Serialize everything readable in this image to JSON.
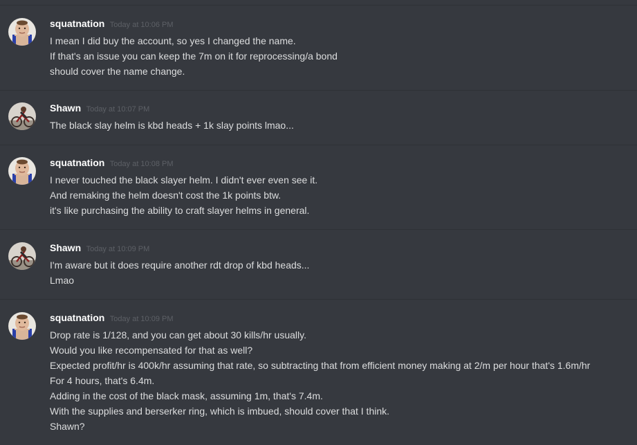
{
  "messages": [
    {
      "author": "squatnation",
      "avatar": "squatnation-avatar-icon",
      "timestamp": "Today at 10:06 PM",
      "lines": [
        "I mean I did buy the account, so yes I changed the name.",
        "If that's an issue you can keep the 7m on it for reprocessing/a bond",
        "should cover the name change."
      ]
    },
    {
      "author": "Shawn",
      "avatar": "shawn-avatar-icon",
      "timestamp": "Today at 10:07 PM",
      "lines": [
        "The black slay helm is kbd heads + 1k slay points lmao..."
      ]
    },
    {
      "author": "squatnation",
      "avatar": "squatnation-avatar-icon",
      "timestamp": "Today at 10:08 PM",
      "lines": [
        "I never touched the black slayer helm.  I didn't ever even see it.",
        "And remaking the helm doesn't cost the 1k points btw.",
        "it's like purchasing the ability to craft slayer helms in general."
      ]
    },
    {
      "author": "Shawn",
      "avatar": "shawn-avatar-icon",
      "timestamp": "Today at 10:09 PM",
      "lines": [
        "I'm aware but it does require another rdt drop of kbd heads...",
        "Lmao"
      ]
    },
    {
      "author": "squatnation",
      "avatar": "squatnation-avatar-icon",
      "timestamp": "Today at 10:09 PM",
      "lines": [
        "Drop rate is 1/128, and you can get about 30 kills/hr usually.",
        "Would you like recompensated for that as well?",
        "Expected profit/hr is 400k/hr assuming that rate, so subtracting that from efficient money making at 2/m per hour that's 1.6m/hr",
        "For 4 hours, that's 6.4m.",
        "Adding in the cost of the black mask, assuming 1m, that's 7.4m.",
        "With the supplies and berserker ring, which is imbued, should cover that I think.",
        "Shawn?"
      ]
    }
  ],
  "colors": {
    "background": "#36393f",
    "divider": "#2e3136",
    "username": "#ffffff",
    "timestamp": "#5d6066",
    "text": "#dcddde"
  }
}
